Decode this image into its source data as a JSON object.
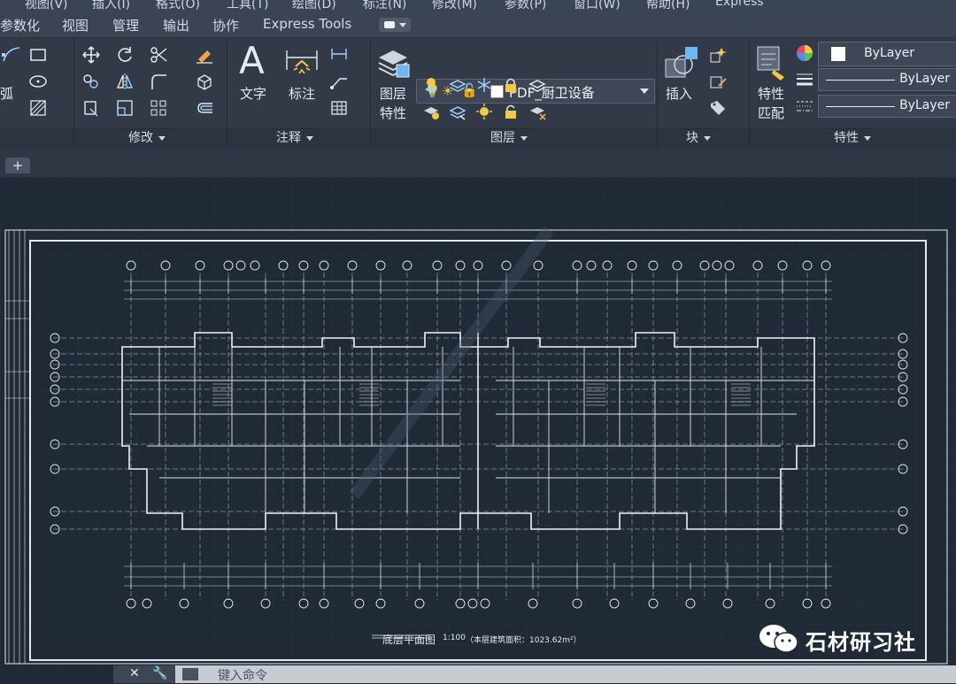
{
  "menubar": {
    "items": [
      "视图(V)",
      "插入(I)",
      "格式(O)",
      "工具(T)",
      "绘图(D)",
      "标注(N)",
      "修改(M)",
      "参数(P)",
      "窗口(W)",
      "帮助(H)",
      "Express"
    ]
  },
  "ribbon_tabs": [
    "参数化",
    "视图",
    "管理",
    "输出",
    "协作",
    "Express Tools"
  ],
  "panels": {
    "draw_arc_label": "弧",
    "modify": "修改",
    "annotation": "注释",
    "layers": "图层",
    "block": "块",
    "properties": "特性"
  },
  "buttons": {
    "text": "文字",
    "dimension": "标注",
    "layer_props_1": "图层",
    "layer_props_2": "特性",
    "insert": "插入",
    "match_props_1": "特性",
    "match_props_2": "匹配"
  },
  "layer_dropdown": {
    "current": "PDF_厨卫设备"
  },
  "properties": {
    "color": "ByLayer",
    "linetype": "ByLayer",
    "lineweight": "ByLayer"
  },
  "drawing": {
    "plan_title": "底层平面图",
    "scale": "1:100",
    "area_note": "（本层建筑面积：1023.62m²）"
  },
  "watermark": {
    "brand": "石材研习社"
  },
  "command_line": {
    "placeholder": "键入命令"
  },
  "colors": {
    "ui_bg": "#323a47",
    "canvas_bg": "#1f2a36",
    "line_white": "#e6e9ed"
  }
}
